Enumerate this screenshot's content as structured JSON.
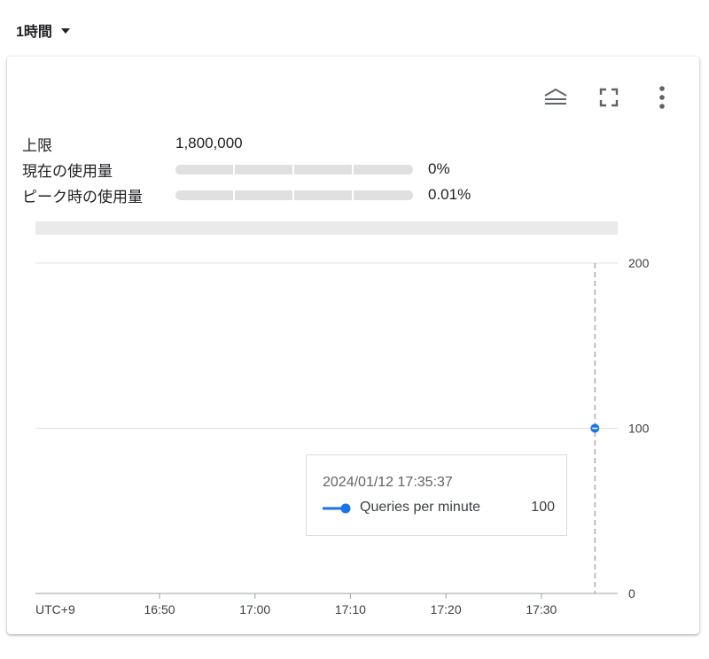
{
  "time_range": {
    "label": "1時間"
  },
  "toolbar": {
    "icons": [
      "legend-toggle-icon",
      "fullscreen-icon",
      "more-vert-icon"
    ]
  },
  "quota": {
    "limit_label": "上限",
    "limit_value": "1,800,000",
    "current_label": "現在の使用量",
    "current_pct": "0%",
    "current_fraction": 0,
    "peak_label": "ピーク時の使用量",
    "peak_pct": "0.01%",
    "peak_fraction": 0.0001
  },
  "chart_data": {
    "type": "line",
    "title": "",
    "xlabel": "",
    "ylabel": "",
    "timezone_label": "UTC+9",
    "x_ticks": [
      "16:50",
      "17:00",
      "17:10",
      "17:20",
      "17:30"
    ],
    "y_ticks": [
      "0",
      "100",
      "200"
    ],
    "ylim": [
      0,
      200
    ],
    "xlim": [
      "16:37:00",
      "17:38:00"
    ],
    "grid": true,
    "series": [
      {
        "name": "Queries per minute",
        "color": "#1a73e8",
        "points": [
          {
            "x": "17:35:37",
            "y": 100
          }
        ]
      }
    ],
    "cursor_x": "17:35:37"
  },
  "tooltip": {
    "timestamp": "2024/01/12 17:35:37",
    "series_name": "Queries per minute",
    "value": "100"
  }
}
